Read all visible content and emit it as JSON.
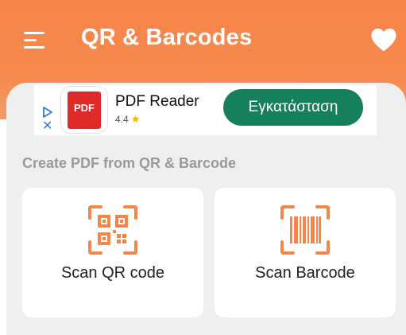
{
  "app": {
    "title": "QR & Barcodes"
  },
  "header": {
    "menu_icon": "menu-icon",
    "favorite_icon": "heart-icon"
  },
  "ad": {
    "app_name": "PDF Reader",
    "icon_text": "PDF",
    "rating": "4.4",
    "install_label": "Εγκατάσταση",
    "install_color": "#16805c"
  },
  "section": {
    "title": "Create PDF from QR & Barcode"
  },
  "cards": [
    {
      "label": "Scan QR code",
      "icon": "qr-code-icon"
    },
    {
      "label": "Scan Barcode",
      "icon": "barcode-icon"
    }
  ],
  "colors": {
    "accent": "#f6854a",
    "background": "#efefef"
  }
}
